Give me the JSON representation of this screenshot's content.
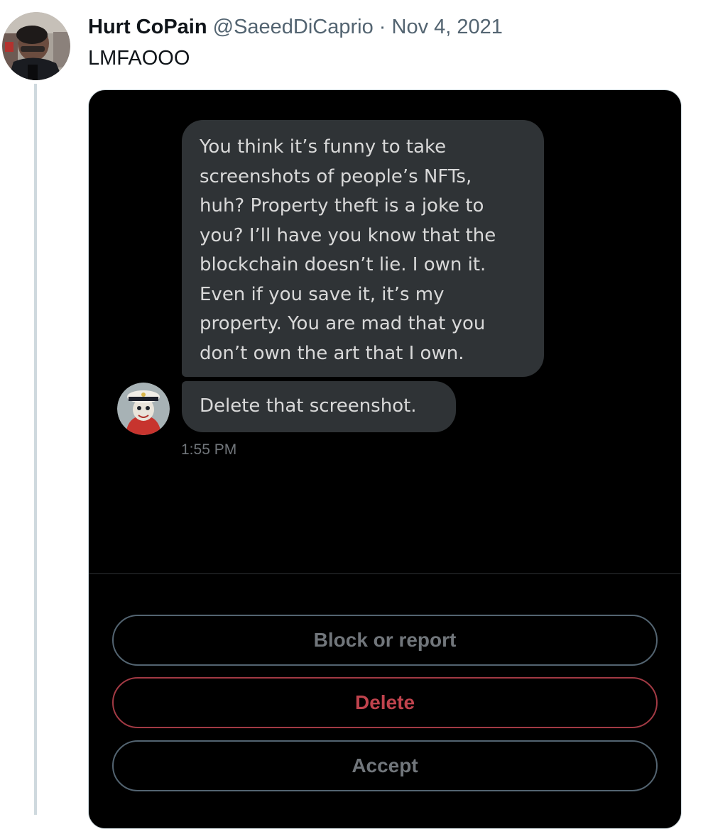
{
  "tweet": {
    "display_name": "Hurt CoPain",
    "handle": "@SaeedDiCaprio",
    "separator": "·",
    "date": "Nov 4, 2021",
    "text": "LMFAOOO"
  },
  "dm": {
    "messages": [
      {
        "lines": [
          "You think it’s funny to take",
          "screenshots of people’s NFTs,",
          "huh? Property theft is a joke to",
          "you? I’ll have you know that the",
          "blockchain doesn’t lie. I own it.",
          "Even if you save it, it’s my",
          "property. You are mad that you",
          "don’t own the art that I own."
        ]
      },
      {
        "text": "Delete that screenshot."
      }
    ],
    "timestamp": "1:55 PM",
    "buttons": {
      "block_label": "Block or report",
      "delete_label": "Delete",
      "accept_label": "Accept"
    }
  },
  "colors": {
    "dm_background": "#000000",
    "bubble": "#2f3336",
    "delete_accent": "#c0434d",
    "muted": "#71767b",
    "thread_line": "#cfd9de"
  },
  "icons": {
    "author_avatar": "user-avatar-photo",
    "sender_avatar": "nft-avatar"
  }
}
